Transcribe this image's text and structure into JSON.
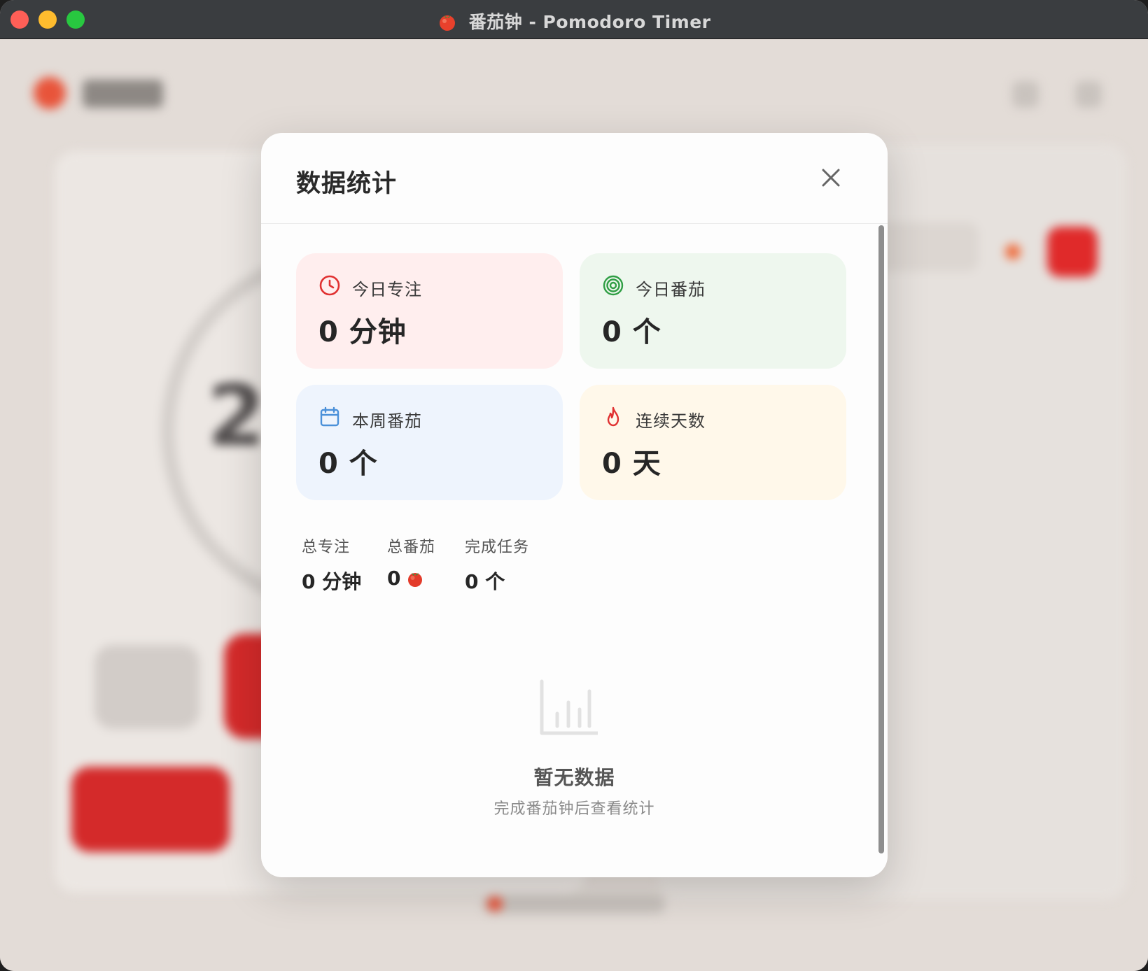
{
  "window": {
    "title": "番茄钟 - Pomodoro Timer",
    "title_icon": "tomato-icon"
  },
  "modal": {
    "title": "数据统计",
    "close_icon": "close-icon",
    "cards": [
      {
        "label": "今日专注",
        "value": "0 分钟",
        "icon": "clock-icon",
        "color": "#e03131"
      },
      {
        "label": "今日番茄",
        "value": "0 个",
        "icon": "target-icon",
        "color": "#2f9e44"
      },
      {
        "label": "本周番茄",
        "value": "0 个",
        "icon": "calendar-icon",
        "color": "#4a90d9"
      },
      {
        "label": "连续天数",
        "value": "0 天",
        "icon": "flame-icon",
        "color": "#e03131"
      }
    ],
    "summary": {
      "total_focus_label": "总专注",
      "total_focus_value": "0 分钟",
      "total_tomato_label": "总番茄",
      "total_tomato_value": "0",
      "tasks_done_label": "完成任务",
      "tasks_done_value": "0 个"
    },
    "empty": {
      "icon": "bar-chart-icon",
      "title": "暂无数据",
      "subtitle": "完成番茄钟后查看统计"
    }
  }
}
